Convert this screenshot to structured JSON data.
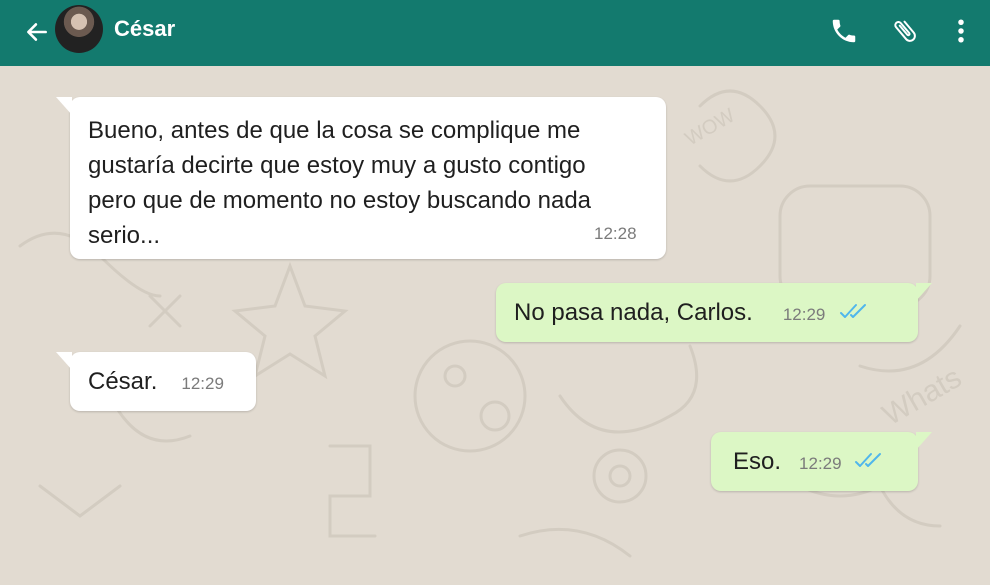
{
  "header": {
    "contact_name": "César",
    "back_icon": "arrow-left-icon",
    "call_icon": "phone-icon",
    "attach_icon": "paperclip-icon",
    "menu_icon": "more-vert-icon"
  },
  "colors": {
    "header": "#137a6e",
    "incoming_bubble": "#ffffff",
    "outgoing_bubble": "#dcf7c5",
    "read_ticks": "#4fb6ec",
    "chat_background": "#e2dbd1"
  },
  "messages": [
    {
      "direction": "incoming",
      "lines": [
        "Bueno, antes de que la cosa se complique me",
        "gustaría decirte que estoy muy a gusto contigo",
        "pero que de momento no estoy buscando nada",
        "serio..."
      ],
      "time": "12:28"
    },
    {
      "direction": "outgoing",
      "text": "No pasa nada, Carlos.",
      "time": "12:29",
      "status": "read"
    },
    {
      "direction": "incoming",
      "text": "César.",
      "time": "12:29"
    },
    {
      "direction": "outgoing",
      "text": "Eso.",
      "time": "12:29",
      "status": "read"
    }
  ]
}
